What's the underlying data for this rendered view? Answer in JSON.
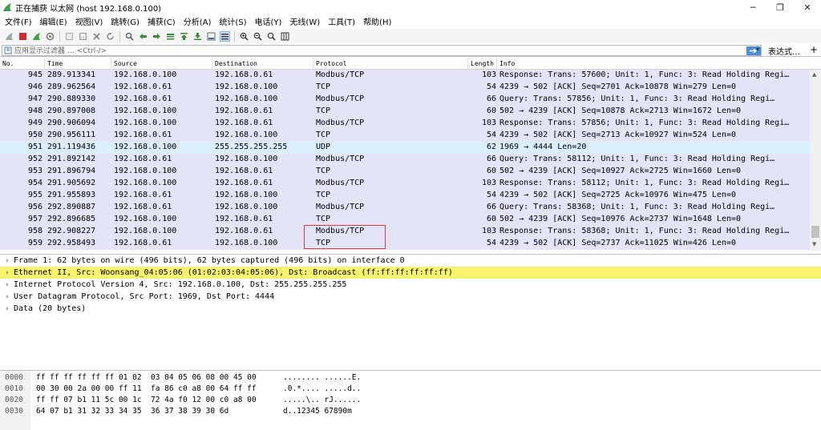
{
  "window": {
    "title": "正在捕获 以太网 (host 192.168.0.100)"
  },
  "menu": [
    "文件(F)",
    "编辑(E)",
    "视图(V)",
    "跳转(G)",
    "捕获(C)",
    "分析(A)",
    "统计(S)",
    "电话(Y)",
    "无线(W)",
    "工具(T)",
    "帮助(H)"
  ],
  "filter": {
    "placeholder": "应用显示过滤器 … <Ctrl-/>",
    "expression_label": "表达式…",
    "plus": "+"
  },
  "packet_list": {
    "columns": {
      "no": "No.",
      "time": "Time",
      "source": "Source",
      "destination": "Destination",
      "protocol": "Protocol",
      "length": "Length",
      "info": "Info"
    },
    "rows": [
      {
        "no": "945",
        "time": "289.913341",
        "src": "192.168.0.100",
        "dst": "192.168.0.61",
        "proto": "Modbus/TCP",
        "len": "103",
        "info": "Response: Trans: 57600; Unit:   1, Func:   3: Read Holding Regi…",
        "color": "#e4e4f8"
      },
      {
        "no": "946",
        "time": "289.962564",
        "src": "192.168.0.61",
        "dst": "192.168.0.100",
        "proto": "TCP",
        "len": "54",
        "info": "4239 → 502 [ACK] Seq=2701 Ack=10878 Win=279 Len=0",
        "color": "#e4e4f8"
      },
      {
        "no": "947",
        "time": "290.889330",
        "src": "192.168.0.61",
        "dst": "192.168.0.100",
        "proto": "Modbus/TCP",
        "len": "66",
        "info": "   Query: Trans: 57856; Unit:   1, Func:   3: Read Holding Regi…",
        "color": "#e4e4f8"
      },
      {
        "no": "948",
        "time": "290.897008",
        "src": "192.168.0.100",
        "dst": "192.168.0.61",
        "proto": "TCP",
        "len": "60",
        "info": "502 → 4239 [ACK] Seq=10878 Ack=2713 Win=1672 Len=0",
        "color": "#e4e4f8"
      },
      {
        "no": "949",
        "time": "290.906094",
        "src": "192.168.0.100",
        "dst": "192.168.0.61",
        "proto": "Modbus/TCP",
        "len": "103",
        "info": "Response: Trans: 57856; Unit:   1, Func:   3: Read Holding Regi…",
        "color": "#e4e4f8"
      },
      {
        "no": "950",
        "time": "290.956111",
        "src": "192.168.0.61",
        "dst": "192.168.0.100",
        "proto": "TCP",
        "len": "54",
        "info": "4239 → 502 [ACK] Seq=2713 Ack=10927 Win=524 Len=0",
        "color": "#e4e4f8"
      },
      {
        "no": "951",
        "time": "291.119436",
        "src": "192.168.0.100",
        "dst": "255.255.255.255",
        "proto": "UDP",
        "len": "62",
        "info": "1969 → 4444 Len=20",
        "color": "#daeefe"
      },
      {
        "no": "952",
        "time": "291.892142",
        "src": "192.168.0.61",
        "dst": "192.168.0.100",
        "proto": "Modbus/TCP",
        "len": "66",
        "info": "   Query: Trans: 58112; Unit:   1, Func:   3: Read Holding Regi…",
        "color": "#e4e4f8"
      },
      {
        "no": "953",
        "time": "291.896794",
        "src": "192.168.0.100",
        "dst": "192.168.0.61",
        "proto": "TCP",
        "len": "60",
        "info": "502 → 4239 [ACK] Seq=10927 Ack=2725 Win=1660 Len=0",
        "color": "#e4e4f8"
      },
      {
        "no": "954",
        "time": "291.905692",
        "src": "192.168.0.100",
        "dst": "192.168.0.61",
        "proto": "Modbus/TCP",
        "len": "103",
        "info": "Response: Trans: 58112; Unit:   1, Func:   3: Read Holding Regi…",
        "color": "#e4e4f8"
      },
      {
        "no": "955",
        "time": "291.955893",
        "src": "192.168.0.61",
        "dst": "192.168.0.100",
        "proto": "TCP",
        "len": "54",
        "info": "4239 → 502 [ACK] Seq=2725 Ack=10976 Win=475 Len=0",
        "color": "#e4e4f8"
      },
      {
        "no": "956",
        "time": "292.890887",
        "src": "192.168.0.61",
        "dst": "192.168.0.100",
        "proto": "Modbus/TCP",
        "len": "66",
        "info": "   Query: Trans: 58368; Unit:   1, Func:   3: Read Holding Regi…",
        "color": "#e4e4f8"
      },
      {
        "no": "957",
        "time": "292.896685",
        "src": "192.168.0.100",
        "dst": "192.168.0.61",
        "proto": "TCP",
        "len": "60",
        "info": "502 → 4239 [ACK] Seq=10976 Ack=2737 Win=1648 Len=0",
        "color": "#e4e4f8"
      },
      {
        "no": "958",
        "time": "292.908227",
        "src": "192.168.0.100",
        "dst": "192.168.0.61",
        "proto": "Modbus/TCP",
        "len": "103",
        "info": "Response: Trans: 58368; Unit:   1, Func:   3: Read Holding Regi…",
        "color": "#e4e4f8"
      },
      {
        "no": "959",
        "time": "292.958493",
        "src": "192.168.0.61",
        "dst": "192.168.0.100",
        "proto": "TCP",
        "len": "54",
        "info": "4239 → 502 [ACK] Seq=2737 Ack=11025 Win=426 Len=0",
        "color": "#e4e4f8"
      }
    ]
  },
  "details": [
    {
      "text": "Frame 1: 62 bytes on wire (496 bits), 62 bytes captured (496 bits) on interface 0",
      "highlight": false
    },
    {
      "text": "Ethernet II, Src: Woonsang_04:05:06 (01:02:03:04:05:06), Dst: Broadcast (ff:ff:ff:ff:ff:ff)",
      "highlight": true
    },
    {
      "text": "Internet Protocol Version 4, Src: 192.168.0.100, Dst: 255.255.255.255",
      "highlight": false
    },
    {
      "text": "User Datagram Protocol, Src Port: 1969, Dst Port: 4444",
      "highlight": false
    },
    {
      "text": "Data (20 bytes)",
      "highlight": false
    }
  ],
  "hex": [
    {
      "offset": "0000",
      "bytes": "ff ff ff ff ff ff 01 02  03 04 05 06 08 00 45 00",
      "ascii": "........ ......E."
    },
    {
      "offset": "0010",
      "bytes": "00 30 00 2a 00 00 ff 11  fa 86 c0 a8 00 64 ff ff",
      "ascii": ".0.*.... .....d.."
    },
    {
      "offset": "0020",
      "bytes": "ff ff 07 b1 11 5c 00 1c  72 4a f0 12 00 c0 a8 00",
      "ascii": ".....\\.. rJ......"
    },
    {
      "offset": "0030",
      "bytes": "64 07 b1 31 32 33 34 35  36 37 38 39 30 6d",
      "ascii": "d..12345 67890m"
    }
  ],
  "colors": {
    "row_default": "#e4e4f8",
    "row_udp": "#daeefe",
    "detail_highlight": "#f7f36c",
    "annotation_box": "#e0393e"
  }
}
